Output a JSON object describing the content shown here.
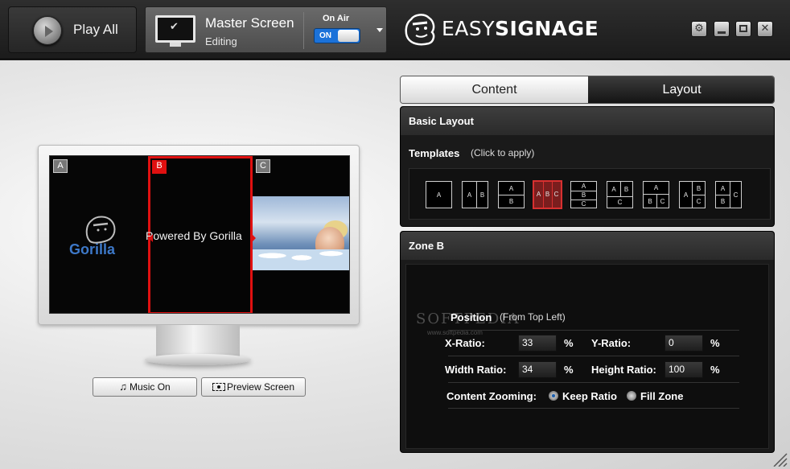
{
  "toolbar": {
    "play_all": "Play All",
    "screen_title": "Master Screen",
    "screen_status": "Editing",
    "on_air_label": "On Air",
    "on_air_toggle": "ON",
    "brand_light": "EASY",
    "brand_bold": "SIGNAGE",
    "window_buttons": [
      "gear-icon",
      "minimize-icon",
      "maximize-icon",
      "close-icon"
    ]
  },
  "preview": {
    "zones": [
      {
        "tag": "A",
        "content": "Gorilla"
      },
      {
        "tag": "B",
        "content": "Powered By Gorilla"
      },
      {
        "tag": "C",
        "content": ""
      }
    ],
    "selected_zone": "B",
    "selection_color": "#e01010"
  },
  "buttons": {
    "music": "Music On",
    "preview": "Preview Screen"
  },
  "tabs": [
    {
      "label": "Content",
      "active": false
    },
    {
      "label": "Layout",
      "active": true
    }
  ],
  "basic_layout": {
    "title": "Basic Layout",
    "templates_label": "Templates",
    "templates_hint": "(Click to apply)",
    "templates": [
      {
        "cells": [
          "A"
        ],
        "selected": false
      },
      {
        "cells": [
          "A",
          "B"
        ],
        "selected": false
      },
      {
        "cells": [
          "A",
          "B"
        ],
        "selected": false
      },
      {
        "cells": [
          "A",
          "B",
          "C"
        ],
        "selected": true
      },
      {
        "cells": [
          "A",
          "B",
          "C"
        ],
        "selected": false
      },
      {
        "cells": [
          "A",
          "B",
          "C"
        ],
        "selected": false
      },
      {
        "cells": [
          "A",
          "B",
          "C"
        ],
        "selected": false
      },
      {
        "cells": [
          "A",
          "B",
          "C"
        ],
        "selected": false
      },
      {
        "cells": [
          "A",
          "B",
          "C"
        ],
        "selected": false
      }
    ]
  },
  "zone_panel": {
    "title": "Zone B",
    "watermark": "SOFTPEDIA",
    "watermark_sub": "www.softpedia.com",
    "position_label": "Position",
    "position_hint": "(From Top Left)",
    "x_ratio_label": "X-Ratio:",
    "x_ratio_value": "33",
    "y_ratio_label": "Y-Ratio:",
    "y_ratio_value": "0",
    "width_ratio_label": "Width Ratio:",
    "width_ratio_value": "34",
    "height_ratio_label": "Height Ratio:",
    "height_ratio_value": "100",
    "percent": "%",
    "zooming_label": "Content Zooming:",
    "keep_ratio": "Keep Ratio",
    "fill_zone": "Fill Zone",
    "zooming_selected": "Keep Ratio"
  }
}
